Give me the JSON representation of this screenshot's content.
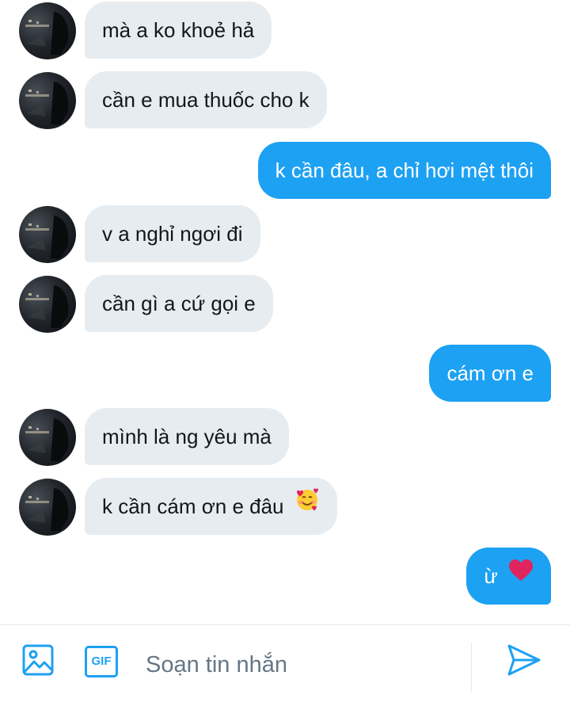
{
  "conversation": {
    "messages": [
      {
        "side": "in",
        "text": "mà a ko khoẻ hả"
      },
      {
        "side": "in",
        "text": "cần e mua thuốc cho k"
      },
      {
        "side": "out",
        "text": "k cần đâu, a chỉ hơi mệt thôi"
      },
      {
        "side": "in",
        "text": "v a nghỉ ngơi đi"
      },
      {
        "side": "in",
        "text": "cần gì a cứ gọi e"
      },
      {
        "side": "out",
        "text": "cám ơn e"
      },
      {
        "side": "in",
        "text": "mình là ng yêu mà"
      },
      {
        "side": "in",
        "text": "k cần cám ơn e đâu",
        "emoji": "smiling-face-with-hearts"
      },
      {
        "side": "out",
        "text": "ừ",
        "emoji": "red-heart"
      }
    ]
  },
  "composer": {
    "placeholder": "Soạn tin nhắn",
    "gif_label": "GIF",
    "icons": {
      "media": "image-icon",
      "gif": "gif-icon",
      "send": "send-icon"
    }
  },
  "colors": {
    "accent": "#1da1f2",
    "incoming_bubble": "#e6ecf0",
    "incoming_text": "#14171a",
    "placeholder_text": "#657786",
    "heart": "#e0245e"
  }
}
